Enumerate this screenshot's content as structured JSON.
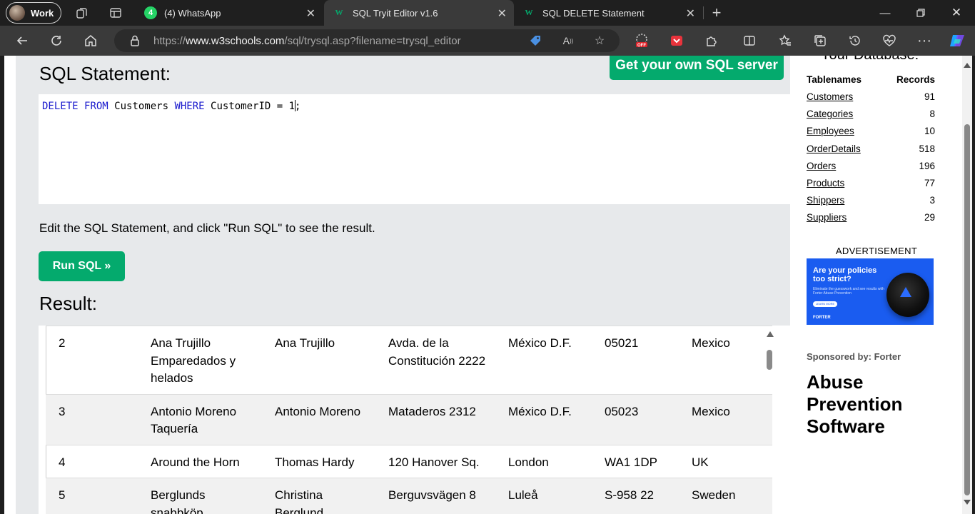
{
  "browser": {
    "profile_label": "Work",
    "tabs": [
      {
        "title": "(4) WhatsApp",
        "badge": "4",
        "icon": "whatsapp-icon",
        "active": false
      },
      {
        "title": "SQL Tryit Editor v1.6",
        "icon": "w3schools-icon",
        "active": true
      },
      {
        "title": "SQL DELETE Statement",
        "icon": "w3schools-icon",
        "active": false
      }
    ],
    "url_prefix": "https://",
    "url_host": "www.w3schools.com",
    "url_path": "/sql/trysql.asp?filename=trysql_editor",
    "off_badge": "OFF"
  },
  "editor": {
    "heading": "SQL Statement:",
    "get_server_label": "Get your own SQL server",
    "sql": {
      "kw1": "DELETE",
      "kw2": "FROM",
      "table": " Customers ",
      "kw3": "WHERE",
      "condition_before_caret": " CustomerID = 1",
      "condition_after_caret": ";"
    },
    "hint": "Edit the SQL Statement, and click \"Run SQL\" to see the result.",
    "run_label": "Run SQL »",
    "result_heading": "Result:"
  },
  "result_rows": [
    {
      "id": "2",
      "name": "Ana Trujillo Emparedados y helados",
      "contact": "Ana Trujillo",
      "address": "Avda. de la Constitución 2222",
      "city": "México D.F.",
      "postal": "05021",
      "country": "Mexico"
    },
    {
      "id": "3",
      "name": "Antonio Moreno Taquería",
      "contact": "Antonio Moreno",
      "address": "Mataderos 2312",
      "city": "México D.F.",
      "postal": "05023",
      "country": "Mexico"
    },
    {
      "id": "4",
      "name": "Around the Horn",
      "contact": "Thomas Hardy",
      "address": "120 Hanover Sq.",
      "city": "London",
      "postal": "WA1 1DP",
      "country": "UK"
    },
    {
      "id": "5",
      "name": "Berglunds snabbköp",
      "contact": "Christina Berglund",
      "address": "Berguvsvägen 8",
      "city": "Luleå",
      "postal": "S-958 22",
      "country": "Sweden"
    }
  ],
  "database": {
    "title": "Your Database:",
    "col_tablenames": "Tablenames",
    "col_records": "Records",
    "tables": [
      {
        "name": "Customers",
        "records": "91"
      },
      {
        "name": "Categories",
        "records": "8"
      },
      {
        "name": "Employees",
        "records": "10"
      },
      {
        "name": "OrderDetails",
        "records": "518"
      },
      {
        "name": "Orders",
        "records": "196"
      },
      {
        "name": "Products",
        "records": "77"
      },
      {
        "name": "Shippers",
        "records": "3"
      },
      {
        "name": "Suppliers",
        "records": "29"
      }
    ]
  },
  "ads": {
    "label": "ADVERTISEMENT",
    "banner_headline": "Are your policies too strict?",
    "banner_body": "Eliminate the guesswork and see results with Forter Abuse Prevention",
    "banner_cta": "LEARN MORE",
    "banner_logo": "FORTER",
    "sponsor": "Sponsored by: Forter",
    "big_text": "Abuse Prevention Software"
  },
  "colors": {
    "accent": "#04aa6d",
    "keyword": "#1a1acd",
    "editor_bg": "#e7e9eb",
    "banner": "#1a5cf0"
  }
}
